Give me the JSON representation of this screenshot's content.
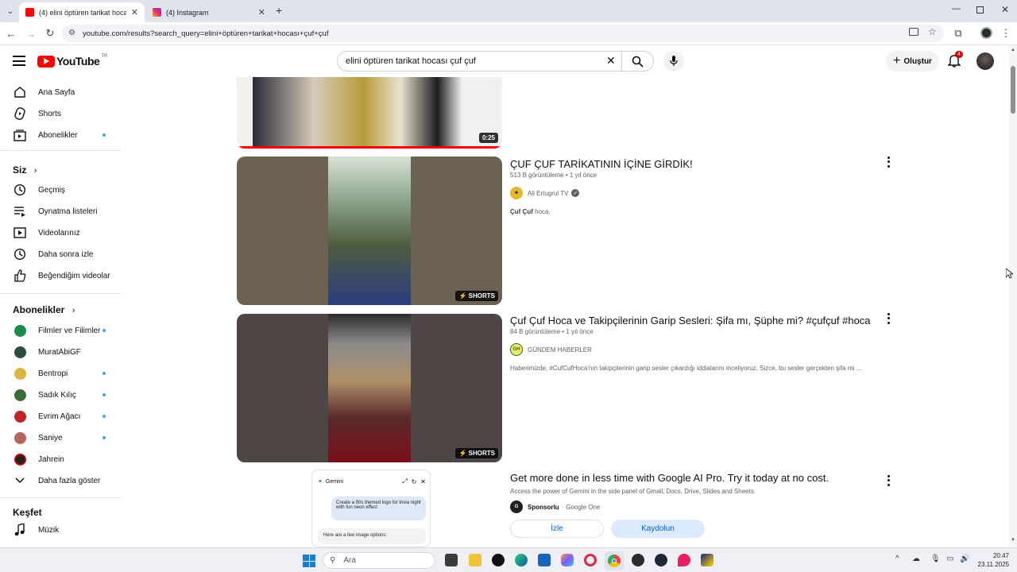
{
  "browser": {
    "tabs": [
      {
        "label": "(4) elini öptüren tarikat hocası ç",
        "active": true
      },
      {
        "label": "(4) Instagram",
        "active": false
      }
    ],
    "new_tab": "+",
    "url": "youtube.com/results?search_query=elini+öptüren+tarikat+hocası+çuf+çuf"
  },
  "header": {
    "logo_text": "YouTube",
    "logo_region": "TR",
    "search_value": "elini öptüren tarikat hocası çuf çuf",
    "create_label": "Oluştur",
    "notification_count": "4"
  },
  "sidebar": {
    "main": [
      {
        "label": "Ana Sayfa",
        "icon": "home-icon"
      },
      {
        "label": "Shorts",
        "icon": "shorts-icon"
      },
      {
        "label": "Abonelikler",
        "icon": "subscriptions-icon"
      }
    ],
    "you_heading": "Siz",
    "you": [
      {
        "label": "Geçmiş",
        "icon": "history-icon"
      },
      {
        "label": "Oynatma listeleri",
        "icon": "playlists-icon"
      },
      {
        "label": "Videolarınız",
        "icon": "your-videos-icon"
      },
      {
        "label": "Daha sonra izle",
        "icon": "watch-later-icon"
      },
      {
        "label": "Beğendiğim videolar",
        "icon": "liked-icon"
      }
    ],
    "subs_heading": "Abonelikler",
    "subs": [
      {
        "label": "Filmler ve Filimler",
        "color": "#1b8a4a",
        "dot": true
      },
      {
        "label": "MuratAbiGF",
        "color": "#2a4d3e",
        "dot": false
      },
      {
        "label": "Bentropi",
        "color": "#e0b341",
        "dot": true
      },
      {
        "label": "Sadık Kılıç",
        "color": "#3a6b3a",
        "dot": true
      },
      {
        "label": "Evrim Ağacı",
        "color": "#c2222b",
        "dot": true
      },
      {
        "label": "Saniye",
        "color": "#b5655a",
        "dot": true
      },
      {
        "label": "Jahrein",
        "color": "#222222",
        "dot": false
      }
    ],
    "show_more": "Daha fazla göster",
    "explore_heading": "Keşfet",
    "explore": [
      {
        "label": "Müzik",
        "icon": "music-icon"
      }
    ]
  },
  "results": [
    {
      "duration": "0:25"
    },
    {
      "title": "ÇUF ÇUF TARİKATININ İÇİNE GİRDİK!",
      "views": "513 B görüntüleme",
      "age": "1 yıl önce",
      "channel": "Ali Ertugrul TV",
      "desc_bold": "Çuf Çuf",
      "desc": " hoca.",
      "badge": "SHORTS"
    },
    {
      "title": "Çuf Çuf Hoca ve Takipçilerinin Garip Sesleri: Şifa mı, Şüphe mi? #çufçuf #hoca",
      "views": "84 B görüntüleme",
      "age": "1 yıl önce",
      "channel": "GÜNDEM HABERLER",
      "channel_initials": "GH",
      "desc": "Haberimizde, #CufCufHoca'nın takipçilerinin garip sesler çıkardığı iddialarını inceliyoruz. Sizce, bu sesler gerçekten şifa mı ...",
      "badge": "SHORTS"
    }
  ],
  "ad": {
    "title": "Get more done in less time with Google AI Pro. Try it today at no cost.",
    "desc": "Access the power of Gemini in the side panel of Gmail, Docs, Drive, Slides and Sheets.",
    "sponsor": "Sponsorlu",
    "advertiser": "Google One",
    "watch_label": "İzle",
    "subscribe_label": "Kaydolun",
    "gemini_title": "Gemini",
    "gemini_prompt": "Create a 90s themed logo for trivia night with fun neon effect",
    "gemini_reply": "Here are a few image options:"
  },
  "taskbar": {
    "search_placeholder": "Ara",
    "time": "20:47",
    "date": "23.11.2025"
  }
}
